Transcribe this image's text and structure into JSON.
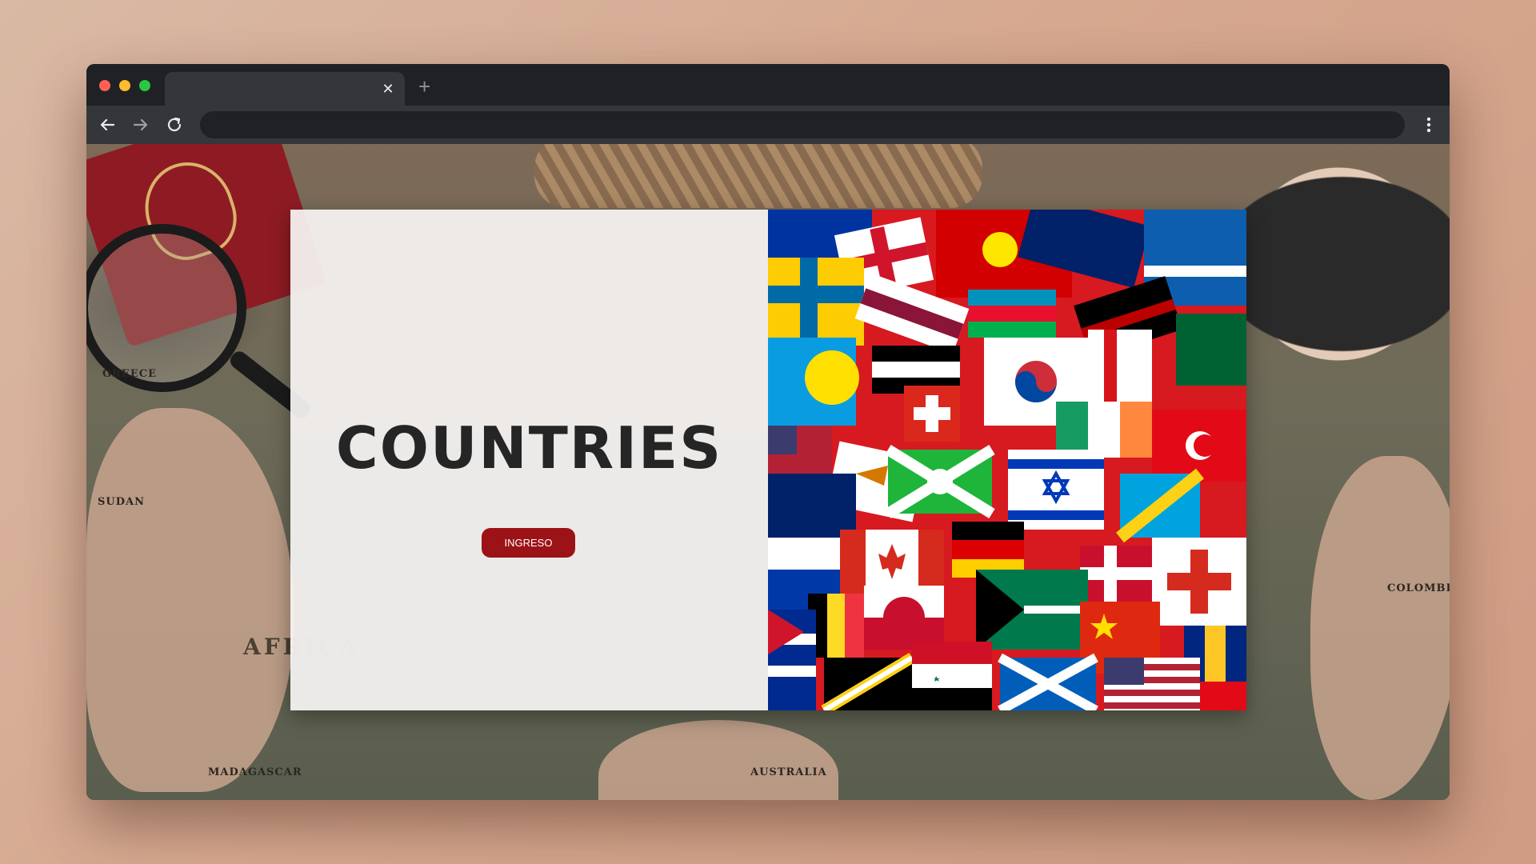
{
  "browser": {
    "tab": {
      "title": "",
      "close_glyph": "✕"
    },
    "new_tab_glyph": "+",
    "address_bar": {
      "value": ""
    },
    "icons": [
      "back-arrow-icon",
      "forward-arrow-icon",
      "reload-icon",
      "kebab-menu-icon"
    ]
  },
  "background": {
    "map_labels": {
      "africa": "AFRICA",
      "australia": "AUSTRALIA",
      "colombia": "COLOMBIA",
      "sudan": "SUDAN",
      "greece": "GREECE",
      "madagascar": "MADAGASCAR"
    }
  },
  "hero": {
    "title": "COUNTRIES",
    "button_label": "INGRESO",
    "button_color": "#9c1317"
  },
  "colors": {
    "window_chrome": "#202124",
    "toolbar": "#35363a",
    "card_panel": "#f6f4f3",
    "title_text": "#252525"
  }
}
